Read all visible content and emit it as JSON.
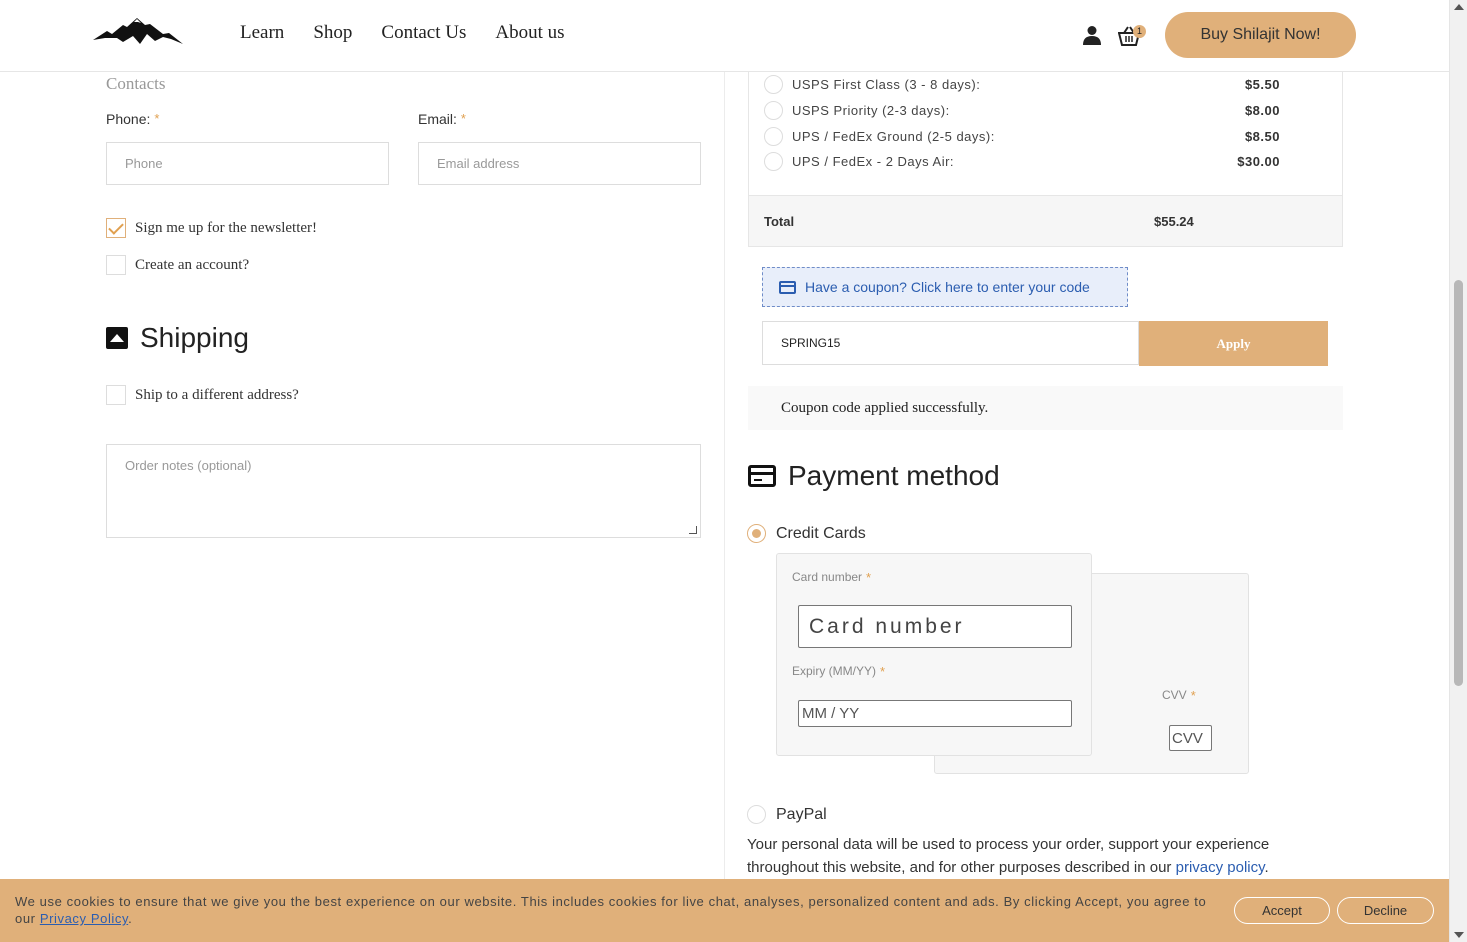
{
  "nav": {
    "items": [
      "Learn",
      "Shop",
      "Contact Us",
      "About us"
    ]
  },
  "header": {
    "cart_count": "1",
    "buy_button": "Buy Shilajit Now!"
  },
  "contacts": {
    "title": "Contacts",
    "phone_label": "Phone:",
    "phone_placeholder": "Phone",
    "email_label": "Email:",
    "email_placeholder": "Email address",
    "required_mark": "*",
    "newsletter_label": "Sign me up for the newsletter!",
    "newsletter_checked": true,
    "create_account_label": "Create an account?"
  },
  "shipping": {
    "title": "Shipping",
    "different_address_label": "Ship to a different address?",
    "notes_placeholder": "Order notes (optional)"
  },
  "shipping_methods": [
    {
      "name": "USPS First Class (3 - 8 days):",
      "price": "$5.50"
    },
    {
      "name": "USPS Priority (2-3 days):",
      "price": "$8.00"
    },
    {
      "name": "UPS / FedEx Ground (2-5 days):",
      "price": "$8.50"
    },
    {
      "name": "UPS / FedEx - 2 Days Air:",
      "price": "$30.00"
    }
  ],
  "total": {
    "label": "Total",
    "value": "$55.24"
  },
  "coupon": {
    "notice": "Have a coupon? Click here to enter your code",
    "code": "SPRING15",
    "apply_label": "Apply",
    "success": "Coupon code applied successfully."
  },
  "payment": {
    "title": "Payment method",
    "credit_cards_label": "Credit Cards",
    "card_number_label": "Card number",
    "card_number_placeholder": "Card number",
    "expiry_label": "Expiry (MM/YY)",
    "expiry_placeholder": "MM / YY",
    "cvv_label": "CVV",
    "cvv_placeholder": "CVV",
    "paypal_label": "PayPal",
    "privacy_text": "Your personal data will be used to process your order, support your experience throughout this website, and for other purposes described in our",
    "privacy_link": "privacy policy",
    "privacy_end": "."
  },
  "cookie": {
    "text": "We use cookies to ensure that we give you the best experience on our website. This includes cookies for live chat, analyses, personalized content and ads. By clicking Accept, you agree to our",
    "link": "Privacy Policy",
    "end": ".",
    "accept": "Accept",
    "decline": "Decline"
  },
  "colors": {
    "accent": "#e0b07a",
    "link": "#2b5db0"
  }
}
